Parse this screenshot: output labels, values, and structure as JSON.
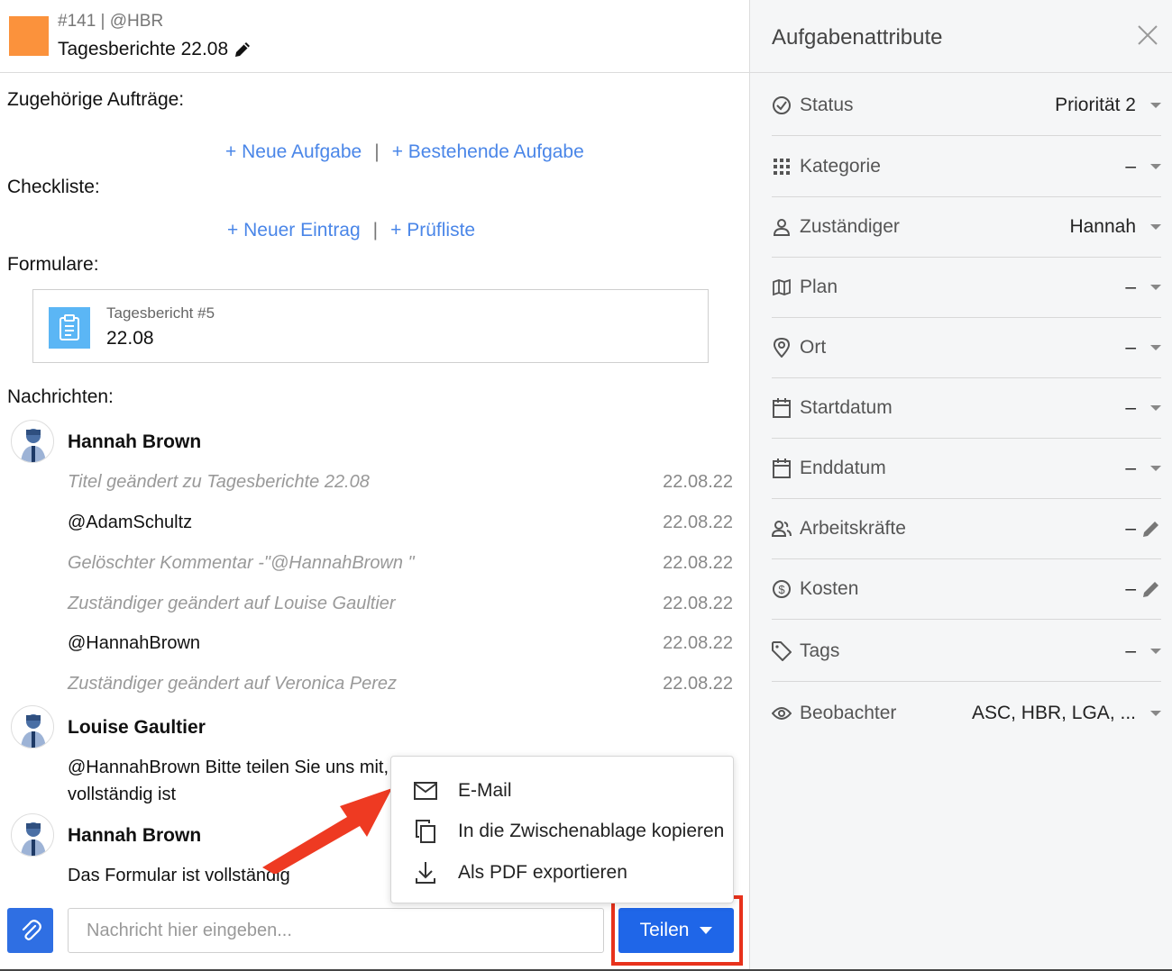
{
  "header": {
    "task_id": "#141 | @HBR",
    "title": "Tagesberichte 22.08",
    "color": "#fb923c"
  },
  "sections": {
    "related_label": "Zugehörige Aufträge:",
    "new_task": "+ Neue Aufgabe",
    "existing_task": "+ Bestehende Aufgabe",
    "checklist_label": "Checkliste:",
    "new_entry": "+ Neuer Eintrag",
    "checklist_link": "+ Prüfliste",
    "forms_label": "Formulare:",
    "separator": "|"
  },
  "form_card": {
    "subtitle": "Tagesbericht #5",
    "value": "22.08"
  },
  "messages_label": "Nachrichten:",
  "messages": {
    "author1": "Hannah Brown",
    "m1": "Titel geändert zu Tagesberichte 22.08",
    "m1_date": "22.08.22",
    "m2": "@AdamSchultz",
    "m2_date": "22.08.22",
    "m3": "Gelöschter Kommentar -\"@HannahBrown \"",
    "m3_date": "22.08.22",
    "m4": "Zuständiger geändert auf Louise Gaultier",
    "m4_date": "22.08.22",
    "m5": "@HannahBrown",
    "m5_date": "22.08.22",
    "m6": "Zuständiger geändert auf Veronica Perez",
    "m6_date": "22.08.22",
    "author2": "Louise Gaultier",
    "m7_line1": "@HannahBrown Bitte teilen Sie uns mit,",
    "m7_line2": "vollständig ist",
    "author3": "Hannah Brown",
    "m8": "Das Formular ist vollständig"
  },
  "composer": {
    "placeholder": "Nachricht hier eingeben...",
    "share_label": "Teilen"
  },
  "share_menu": {
    "email": "E-Mail",
    "clipboard": "In die Zwischenablage kopieren",
    "pdf": "Als PDF exportieren"
  },
  "panel": {
    "title": "Aufgabenattribute",
    "attrs": [
      {
        "label": "Status",
        "value": "Priorität 2",
        "icon": "check-circle-icon"
      },
      {
        "label": "Kategorie",
        "value": "–",
        "icon": "grid-icon"
      },
      {
        "label": "Zuständiger",
        "value": "Hannah",
        "icon": "person-icon"
      },
      {
        "label": "Plan",
        "value": "–",
        "icon": "map-icon"
      },
      {
        "label": "Ort",
        "value": "–",
        "icon": "location-pin-icon"
      },
      {
        "label": "Startdatum",
        "value": "–",
        "icon": "calendar-icon"
      },
      {
        "label": "Enddatum",
        "value": "–",
        "icon": "calendar-icon"
      },
      {
        "label": "Arbeitskräfte",
        "value": "–",
        "icon": "people-icon"
      },
      {
        "label": "Kosten",
        "value": "–",
        "icon": "dollar-circle-icon"
      },
      {
        "label": "Tags",
        "value": "–",
        "icon": "tag-icon"
      },
      {
        "label": "Beobachter",
        "value": "ASC, HBR, LGA, ...",
        "icon": "eye-icon"
      }
    ]
  },
  "colors": {
    "link": "#4a86e8",
    "primary": "#1f66e8",
    "highlight": "#e8321c"
  }
}
